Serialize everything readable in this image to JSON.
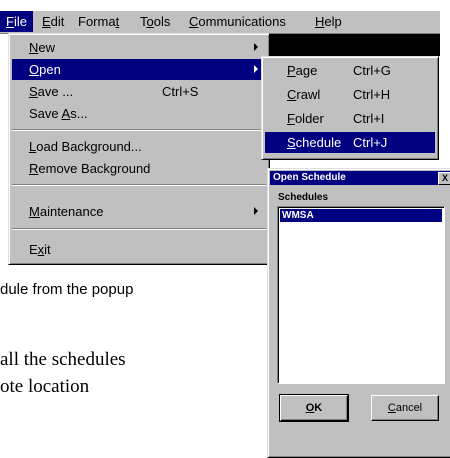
{
  "menubar": {
    "items": [
      {
        "label": "File",
        "accel": "F",
        "rest": "ile"
      },
      {
        "label": "Edit",
        "accel": "E",
        "rest": "dit"
      },
      {
        "label": "Format",
        "pre": "Forma",
        "accel": "t",
        "rest": ""
      },
      {
        "label": "Tools",
        "pre": "T",
        "accel": "o",
        "rest": "ols"
      },
      {
        "label": "Communications",
        "accel": "C",
        "rest": "ommunications"
      },
      {
        "label": "Help",
        "accel": "H",
        "rest": "elp"
      }
    ]
  },
  "file_menu": {
    "items": [
      {
        "pre": "",
        "accel": "N",
        "rest": "ew",
        "shortcut": "",
        "submenu": true
      },
      {
        "pre": "",
        "accel": "O",
        "rest": "pen",
        "shortcut": "",
        "submenu": true
      },
      {
        "pre": "",
        "accel": "S",
        "rest": "ave ...",
        "shortcut": "Ctrl+S",
        "submenu": false
      },
      {
        "pre": "Save ",
        "accel": "A",
        "rest": "s...",
        "shortcut": "",
        "submenu": false
      },
      {
        "pre": "",
        "accel": "L",
        "rest": "oad Background...",
        "shortcut": "",
        "submenu": false
      },
      {
        "pre": "",
        "accel": "R",
        "rest": "emove Background",
        "shortcut": "",
        "submenu": false
      },
      {
        "pre": "",
        "accel": "M",
        "rest": "aintenance",
        "shortcut": "",
        "submenu": true
      },
      {
        "pre": "E",
        "accel": "x",
        "rest": "it",
        "shortcut": "",
        "submenu": false
      }
    ]
  },
  "open_submenu": {
    "items": [
      {
        "accel": "P",
        "rest": "age",
        "shortcut": "Ctrl+G"
      },
      {
        "accel": "C",
        "rest": "rawl",
        "shortcut": "Ctrl+H"
      },
      {
        "accel": "F",
        "rest": "older",
        "shortcut": "Ctrl+I"
      },
      {
        "accel": "S",
        "rest": "chedule",
        "shortcut": "Ctrl+J"
      }
    ]
  },
  "text": {
    "line1": "dule from the popup",
    "line2": "all the schedules",
    "line3": "ote location"
  },
  "dialog": {
    "title": "Open Schedule",
    "close": "X",
    "list_label": "Schedules",
    "items": [
      "WMSA"
    ],
    "ok": {
      "accel": "O",
      "rest": "K"
    },
    "cancel": {
      "accel": "C",
      "rest": "ancel"
    }
  },
  "colors": {
    "menu_bg": "#c0c0c0",
    "highlight": "#000080"
  }
}
